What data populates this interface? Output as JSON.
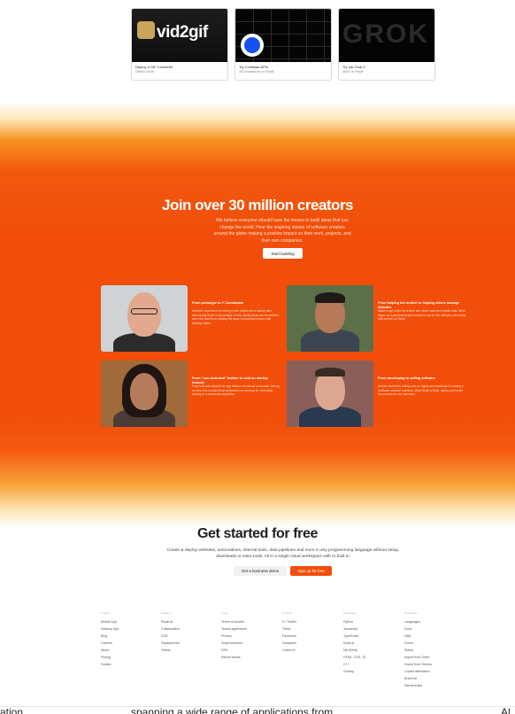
{
  "templates": [
    {
      "title": "Deploy a GIF Converter",
      "subtitle": "Official Guide",
      "thumb_text": "vid2gif"
    },
    {
      "title": "Try Coinbase APIs",
      "subtitle": "@CoinbaseDev on Replit",
      "thumb_text": ""
    },
    {
      "title": "Try xAI Grok 2",
      "subtitle": "@xAI on Replit",
      "thumb_text": "GROK"
    }
  ],
  "hero": {
    "title": "Join over 30 million creators",
    "subtitle": "We believe everyone should have the means to build ideas that can change the world. Hear the inspiring stories of software creators around the globe making a positive impact on their work, projects, and their own companies.",
    "cta": "Start building"
  },
  "stories": [
    {
      "title": "From prototype to Y Combinator",
      "text": "Andrew's experience of turning a side project into a startup after discovering Replit is an example of how quickly ideas can be realized when the barriers to building fall away. A successful launch with funding helped."
    },
    {
      "title": "From helping his brother to helping others manage diabetes",
      "text": "Nasim's app helps his brother and others track their health data. What began as a personal project became a tool for the diabetes community built entirely on Replit."
    },
    {
      "title": "From \"non-technical\" builder to sold on startup founder",
      "text": "Priya built and shipped her app without a technical co-founder, turning an idea into a product that customers use and pay for, eventually leading to a successful acquisition."
    },
    {
      "title": "From developing to selling software",
      "text": "Andrew went from writing code on nights and weekends to running a profitable software business, using Replit to build, deploy and iterate on products for his customers."
    }
  ],
  "get_started": {
    "title": "Get started for free",
    "subtitle": "Create & deploy websites, automations, internal tools, data pipelines and more in any programming language without setup, downloads or extra tools. All in a single cloud workspace with AI built in.",
    "demo_label": "Get a business demo",
    "signup_label": "Sign up for free"
  },
  "footer": [
    {
      "heading": "Product",
      "links": [
        "Mobile App",
        "Desktop App",
        "Blog",
        "Careers",
        "About",
        "Pricing",
        "Guides"
      ]
    },
    {
      "heading": "Features",
      "links": [
        "Replit AI",
        "Collaboration",
        "CDE",
        "Deployments",
        "Teams"
      ]
    },
    {
      "heading": "Legal",
      "links": [
        "Terms of service",
        "Teams agreement",
        "Privacy",
        "Subprocessors",
        "DPA",
        "Report abuse"
      ]
    },
    {
      "heading": "Connect",
      "links": [
        "X / Twitter",
        "Tiktok",
        "Facebook",
        "Instagram",
        "Linked In"
      ]
    },
    {
      "heading": "Languages",
      "links": [
        "Python",
        "Javascript",
        "TypeScript",
        "Node.js",
        "Nix (Beta)",
        "HTML, CSS, JS",
        "C++",
        "Golang"
      ]
    },
    {
      "heading": "Resources",
      "links": [
        "Languages",
        "Docs",
        "Help",
        "Forum",
        "Status",
        "Import from Glitch",
        "Import from Heroku",
        "Copilot alternative",
        "Brand kit",
        "Partnerships"
      ]
    }
  ],
  "bottom_strip": {
    "left": "ation",
    "center": "spanning a wide range of applications from",
    "right": "Al"
  },
  "colors": {
    "accent": "#f04e0a",
    "hero_orange": "#f25a0f"
  }
}
